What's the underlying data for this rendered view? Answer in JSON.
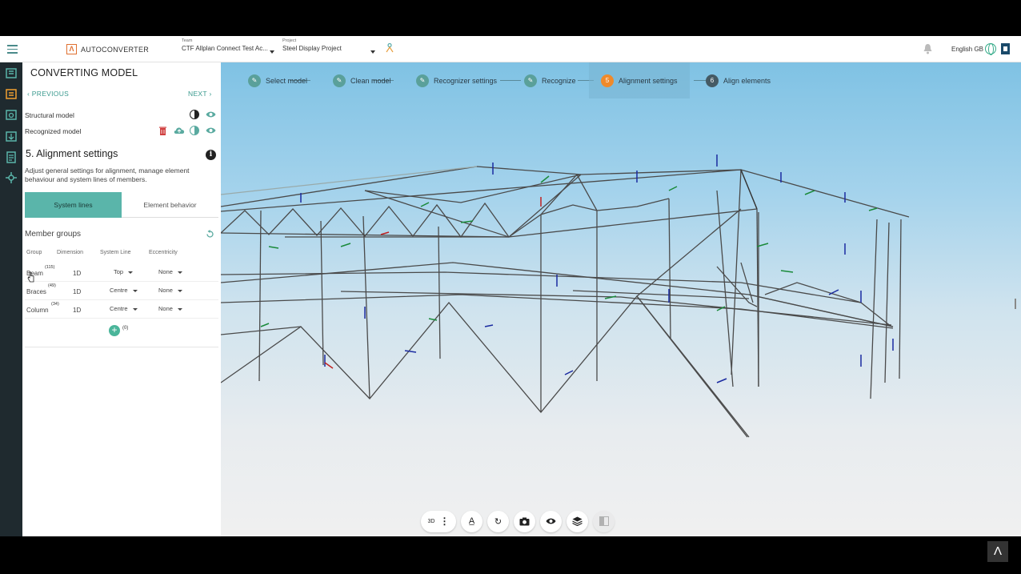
{
  "app": {
    "name": "AUTOCONVERTER"
  },
  "header": {
    "team_caption": "Team",
    "team_value": "CTF Allplan Connect Test Ac...",
    "project_caption": "Project",
    "project_value": "Steel Display Project",
    "language": "English GB"
  },
  "panel": {
    "title": "CONVERTING MODEL",
    "previous": "PREVIOUS",
    "next": "NEXT",
    "structural_model": "Structural model",
    "recognized_model": "Recognized model",
    "section_title": "5.  Alignment settings",
    "description": "Adjust general settings for alignment, manage element behaviour and system lines of members.",
    "tabs": [
      "System lines",
      "Element behavior"
    ],
    "member_groups_title": "Member groups",
    "columns": [
      "Group",
      "Dimension",
      "System Line",
      "Eccentricity"
    ],
    "rows": [
      {
        "group": "Beam",
        "count": "(115)",
        "dimension": "1D",
        "system_line": "Top",
        "eccentricity": "None"
      },
      {
        "group": "Braces",
        "count": "(49)",
        "dimension": "1D",
        "system_line": "Centre",
        "eccentricity": "None"
      },
      {
        "group": "Column",
        "count": "(34)",
        "dimension": "1D",
        "system_line": "Centre",
        "eccentricity": "None"
      }
    ],
    "add_count": "(0)"
  },
  "stepper": [
    {
      "number": "",
      "label": "Select model",
      "state": "done"
    },
    {
      "number": "",
      "label": "Clean model",
      "state": "done"
    },
    {
      "number": "",
      "label": "Recognizer settings",
      "state": "done"
    },
    {
      "number": "",
      "label": "Recognize",
      "state": "done"
    },
    {
      "number": "5",
      "label": "Alignment settings",
      "state": "current"
    },
    {
      "number": "6",
      "label": "Align elements",
      "state": "pending"
    }
  ],
  "toolbar": {
    "view_mode": "3D"
  },
  "colors": {
    "accent": "#5ab5aa",
    "current_step": "#f08a2a",
    "rail": "#1f2a2f"
  },
  "icons": [
    "menu-icon",
    "bell-icon",
    "globe-icon",
    "exit-icon",
    "contrast-icon",
    "eye-icon",
    "trash-icon",
    "upload-icon",
    "info-icon",
    "reset-icon",
    "pencil-icon",
    "camera-icon",
    "layers-icon"
  ]
}
